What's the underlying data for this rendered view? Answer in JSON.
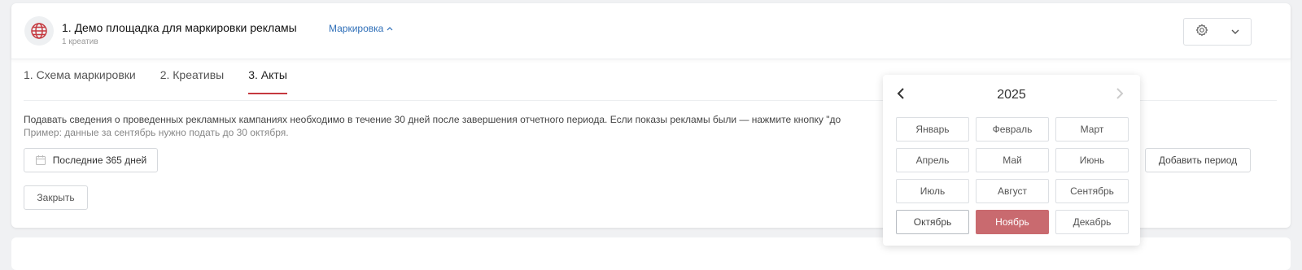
{
  "header": {
    "title": "1. Демо площадка для маркировки рекламы",
    "subtitle": "1 креатив",
    "marking_link": "Маркировка"
  },
  "tabs": [
    {
      "label": "1. Схема маркировки"
    },
    {
      "label": "2. Креативы"
    },
    {
      "label": "3. Акты"
    }
  ],
  "content": {
    "notice": "Подавать сведения о проведенных рекламных кампаниях необходимо в течение 30 дней после завершения отчетного периода. Если показы рекламы были — нажмите кнопку \"до",
    "example": "Пример: данные за сентябрь нужно подать до 30 октября.",
    "period_button": "Последние 365 дней",
    "close_button": "Закрыть",
    "add_period_button": "Добавить период"
  },
  "month_picker": {
    "year": "2025",
    "months": [
      "Январь",
      "Февраль",
      "Март",
      "Апрель",
      "Май",
      "Июнь",
      "Июль",
      "Август",
      "Сентябрь",
      "Октябрь",
      "Ноябрь",
      "Декабрь"
    ],
    "selected_month": "Ноябрь",
    "focused_month": "Октябрь"
  },
  "colors": {
    "accent": "#c5393f",
    "selected_month_bg": "#c96a6f",
    "link": "#2f6fb8"
  },
  "icons": {
    "avatar": "globe-icon",
    "chevron_up": "chevron-up-icon",
    "settings": "gear-icon",
    "dropdown": "chevron-down-icon",
    "calendar": "calendar-icon",
    "prev": "chevron-left-icon",
    "next": "chevron-right-icon"
  }
}
